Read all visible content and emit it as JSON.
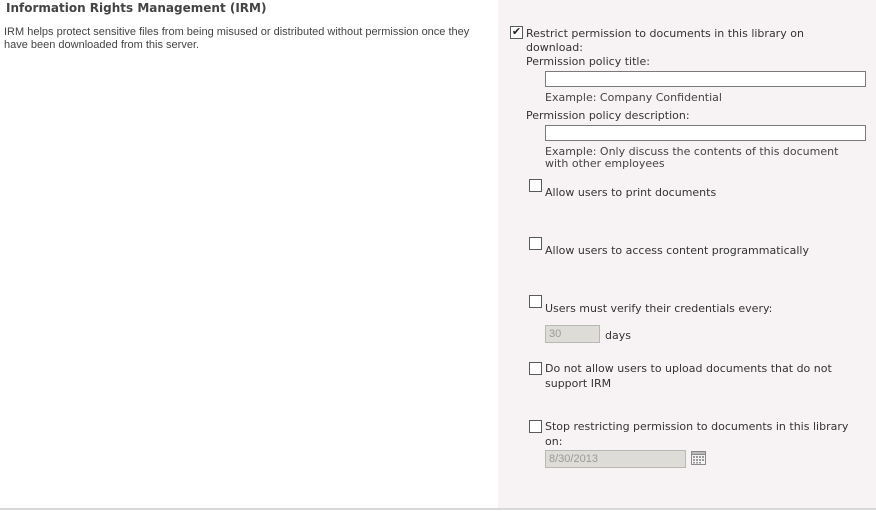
{
  "section": {
    "title": "Information Rights Management (IRM)",
    "description": "IRM helps protect sensitive files from being misused or distributed without permission once they have been downloaded from this server."
  },
  "restrict": {
    "label_line1": "Restrict permission to documents in this library on",
    "label_line2": "download:",
    "checked": true
  },
  "policy_title": {
    "label": "Permission policy title:",
    "value": "",
    "example": "Example: Company Confidential"
  },
  "policy_description": {
    "label": "Permission policy description:",
    "value": "",
    "example_line1": "Example: Only discuss the contents of this document",
    "example_line2": "with other employees"
  },
  "allow_print": {
    "label": "Allow users to print documents",
    "checked": false
  },
  "allow_programmatic": {
    "label": "Allow users to access content programmatically",
    "checked": false
  },
  "verify_credentials": {
    "label": "Users must verify their credentials every:",
    "checked": false,
    "days_value": "30",
    "days_label": "days"
  },
  "no_upload": {
    "label_line1": "Do not allow users to upload documents that do not",
    "label_line2": "support IRM",
    "checked": false
  },
  "stop_restricting": {
    "label_line1": "Stop restricting permission to documents in this library",
    "label_line2": "on:",
    "checked": false,
    "date_value": "8/30/2013"
  },
  "icons": {
    "calendar": "calendar-icon",
    "checkmark": "checkmark-icon"
  },
  "colors": {
    "panel_background": "#f7f3f5",
    "disabled_field": "#dddcd7"
  }
}
